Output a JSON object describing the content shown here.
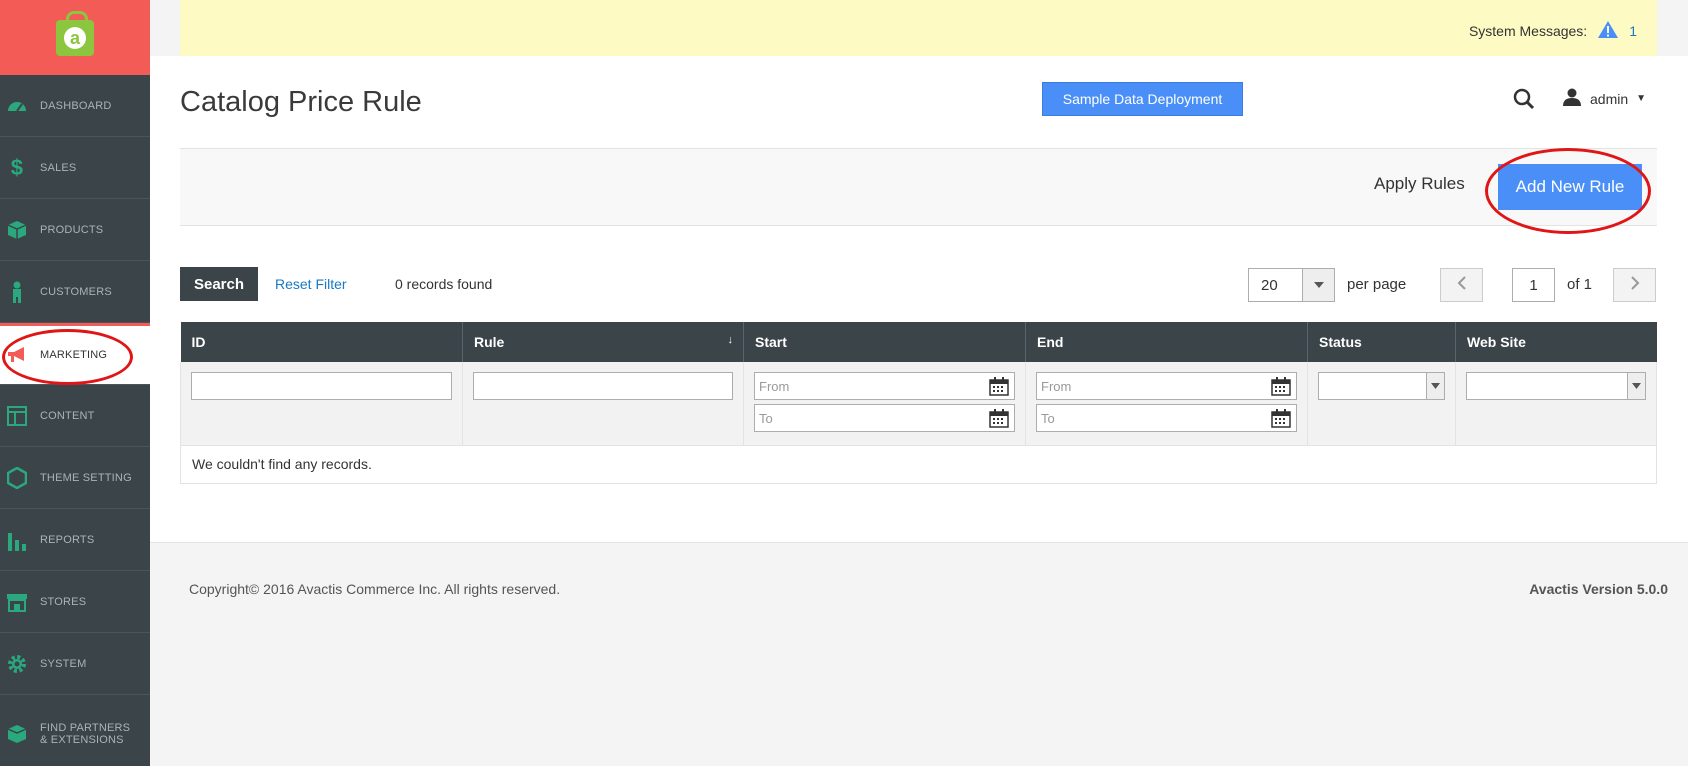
{
  "sidebar": {
    "items": [
      {
        "label": "DASHBOARD",
        "icon": "dashboard-icon"
      },
      {
        "label": "SALES",
        "icon": "dollar-icon"
      },
      {
        "label": "PRODUCTS",
        "icon": "cube-icon"
      },
      {
        "label": "CUSTOMERS",
        "icon": "person-icon"
      },
      {
        "label": "MARKETING",
        "icon": "megaphone-icon"
      },
      {
        "label": "CONTENT",
        "icon": "layout-icon"
      },
      {
        "label": "THEME SETTING",
        "icon": "hexagon-icon"
      },
      {
        "label": "REPORTS",
        "icon": "bar-chart-icon"
      },
      {
        "label": "STORES",
        "icon": "store-icon"
      },
      {
        "label": "SYSTEM",
        "icon": "gear-icon"
      },
      {
        "label": "FIND PARTNERS & EXTENSIONS",
        "icon": "box-icon"
      }
    ],
    "active": "MARKETING"
  },
  "header": {
    "system_messages_label": "System Messages:",
    "system_messages_count": "1",
    "page_title": "Catalog Price Rule",
    "sample_data_button": "Sample Data Deployment",
    "user_name": "admin"
  },
  "actions": {
    "apply_rules": "Apply Rules",
    "add_new_rule": "Add New Rule"
  },
  "grid_controls": {
    "search_button": "Search",
    "reset_filter": "Reset Filter",
    "records_found": "0 records found",
    "per_page_value": "20",
    "per_page_label": "per page",
    "current_page": "1",
    "total_pages_label": "of 1"
  },
  "table": {
    "columns": [
      "ID",
      "Rule",
      "Start",
      "End",
      "Status",
      "Web Site"
    ],
    "sort_indicator": "↓",
    "date_from_placeholder": "From",
    "date_to_placeholder": "To",
    "empty_message": "We couldn't find any records."
  },
  "footer": {
    "copyright": "Copyright© 2016 Avactis Commerce Inc. All rights reserved.",
    "version": "Avactis Version 5.0.0"
  },
  "colors": {
    "accent": "#4a8ff7",
    "sidebar_bg": "#3b4449",
    "logo_bg": "#f35b57",
    "nav_icon": "#2aa87e",
    "highlight_ring": "#e01515"
  }
}
